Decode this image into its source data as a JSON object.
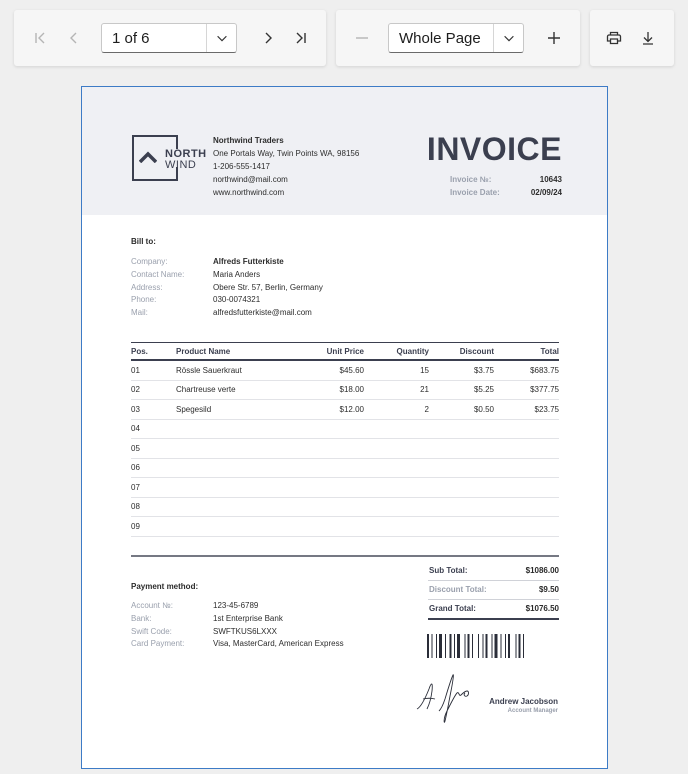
{
  "toolbar": {
    "page_selector": "1 of 6",
    "zoom_selector": "Whole Page"
  },
  "invoice": {
    "logo_line1": "NORTH",
    "logo_line2": "WIND",
    "company": {
      "name": "Northwind Traders",
      "address": "One Portals Way, Twin Points WA, 98156",
      "phone": "1-206-555-1417",
      "email": "northwind@mail.com",
      "website": "www.northwind.com"
    },
    "title": "INVOICE",
    "number_label": "Invoice №:",
    "number": "10643",
    "date_label": "Invoice Date:",
    "date": "02/09/24",
    "bill_to_label": "Bill to:",
    "customer": [
      {
        "label": "Company:",
        "value": "Alfreds Futterkiste"
      },
      {
        "label": "Contact Name:",
        "value": "Maria Anders"
      },
      {
        "label": "Address:",
        "value": "Obere Str. 57, Berlin, Germany"
      },
      {
        "label": "Phone:",
        "value": "030-0074321"
      },
      {
        "label": "Mail:",
        "value": "alfredsfutterkiste@mail.com"
      }
    ],
    "columns": [
      "Pos.",
      "Product Name",
      "Unit Price",
      "Quantity",
      "Discount",
      "Total"
    ],
    "rows": [
      [
        "01",
        "Rössle Sauerkraut",
        "$45.60",
        "15",
        "$3.75",
        "$683.75"
      ],
      [
        "02",
        "Chartreuse verte",
        "$18.00",
        "21",
        "$5.25",
        "$377.75"
      ],
      [
        "03",
        "Spegesild",
        "$12.00",
        "2",
        "$0.50",
        "$23.75"
      ],
      [
        "04",
        "",
        "",
        "",
        "",
        ""
      ],
      [
        "05",
        "",
        "",
        "",
        "",
        ""
      ],
      [
        "06",
        "",
        "",
        "",
        "",
        ""
      ],
      [
        "07",
        "",
        "",
        "",
        "",
        ""
      ],
      [
        "08",
        "",
        "",
        "",
        "",
        ""
      ],
      [
        "09",
        "",
        "",
        "",
        "",
        ""
      ]
    ],
    "totals": [
      {
        "label": "Sub Total:",
        "value": "$1086.00"
      },
      {
        "label": "Discount Total:",
        "value": "$9.50"
      },
      {
        "label": "Grand Total:",
        "value": "$1076.50"
      }
    ],
    "payment_label": "Payment method:",
    "payment": [
      {
        "label": "Account №:",
        "value": "123-45-6789"
      },
      {
        "label": "Bank:",
        "value": "1st Enterprise Bank"
      },
      {
        "label": "Swift Code:",
        "value": "SWFTKUS6LXXX"
      },
      {
        "label": "Card Payment:",
        "value": "Visa, MasterCard, American Express"
      }
    ],
    "signer_name": "Andrew Jacobson",
    "signer_role": "Account Manager"
  },
  "colors": {
    "accent": "#3b3f4f",
    "muted": "#9aa0ad",
    "header_bg": "#eff0f4",
    "page_border": "#3d7bc6"
  },
  "icons": [
    "first-page-icon",
    "previous-page-icon",
    "chevron-down-icon",
    "next-page-icon",
    "last-page-icon",
    "zoom-out-icon",
    "zoom-in-icon",
    "print-icon",
    "download-icon"
  ]
}
